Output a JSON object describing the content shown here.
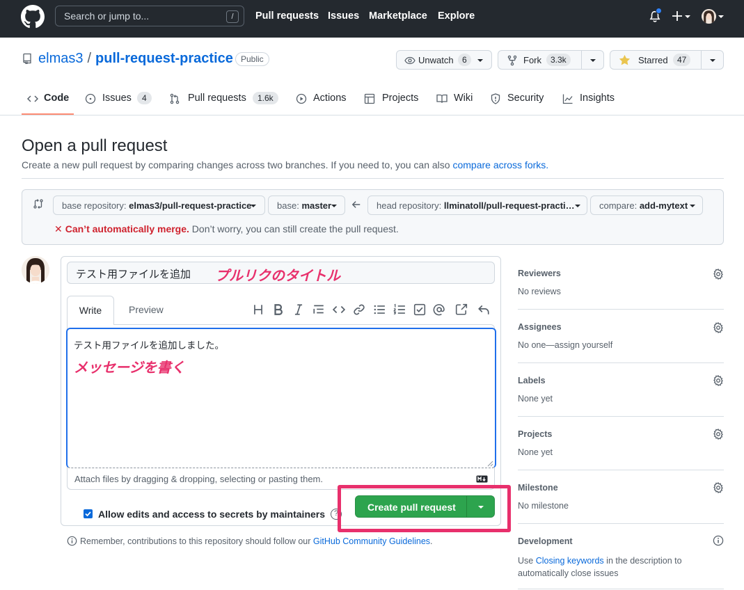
{
  "header": {
    "search_placeholder": "Search or jump to...",
    "search_shortcut": "/",
    "nav": [
      "Pull requests",
      "Issues",
      "Marketplace",
      "Explore"
    ]
  },
  "repo": {
    "owner": "elmas3",
    "name": "pull-request-practice",
    "visibility": "Public",
    "watch_label": "Unwatch",
    "watch_count": "6",
    "fork_label": "Fork",
    "fork_count": "3.3k",
    "star_label": "Starred",
    "star_count": "47"
  },
  "tabs": [
    {
      "label": "Code",
      "icon": "code-icon"
    },
    {
      "label": "Issues",
      "count": "4",
      "icon": "issue-icon"
    },
    {
      "label": "Pull requests",
      "count": "1.6k",
      "icon": "pull-request-icon"
    },
    {
      "label": "Actions",
      "icon": "play-icon"
    },
    {
      "label": "Projects",
      "icon": "table-icon"
    },
    {
      "label": "Wiki",
      "icon": "book-icon"
    },
    {
      "label": "Security",
      "icon": "shield-icon"
    },
    {
      "label": "Insights",
      "icon": "graph-icon"
    }
  ],
  "page": {
    "title": "Open a pull request",
    "subtitle": "Create a new pull request by comparing changes across two branches. If you need to, you can also",
    "subtitle_link": "compare across forks."
  },
  "compare": {
    "base_repo_label": "base repository:",
    "base_repo": "elmas3/pull-request-practice",
    "base_label": "base:",
    "base": "master",
    "head_repo_label": "head repository:",
    "head_repo": "llminatoll/pull-request-practi…",
    "compare_label": "compare:",
    "compare": "add-mytext",
    "merge_status": "Can’t automatically merge.",
    "merge_note": "Don’t worry, you can still create the pull request."
  },
  "form": {
    "title_value": "テスト用ファイルを追加",
    "title_annotation": "プルリクのタイトル",
    "write_tab": "Write",
    "preview_tab": "Preview",
    "body_value": "テスト用ファイルを追加しました。",
    "body_annotation": "メッセージを書く",
    "attach_hint": "Attach files by dragging & dropping, selecting or pasting them.",
    "allow_edits": "Allow edits and access to secrets by maintainers",
    "help_mark": "?",
    "create_button": "Create pull request",
    "remember_text": "Remember, contributions to this repository should follow our",
    "remember_link": "GitHub Community Guidelines",
    "remember_end": "."
  },
  "sidebar": {
    "reviewers_title": "Reviewers",
    "reviewers_value": "No reviews",
    "assignees_title": "Assignees",
    "assignees_value": "No one—assign yourself",
    "labels_title": "Labels",
    "labels_value": "None yet",
    "projects_title": "Projects",
    "projects_value": "None yet",
    "milestone_title": "Milestone",
    "milestone_value": "No milestone",
    "development_title": "Development",
    "development_pre": "Use",
    "development_link": "Closing keywords",
    "development_post": "in the description to",
    "development_line2": "automatically close issues"
  },
  "colors": {
    "header_bg": "#24292f",
    "link": "#0969da",
    "primary_button": "#2da44e",
    "error": "#cf222e",
    "annotation": "#e8306c"
  }
}
